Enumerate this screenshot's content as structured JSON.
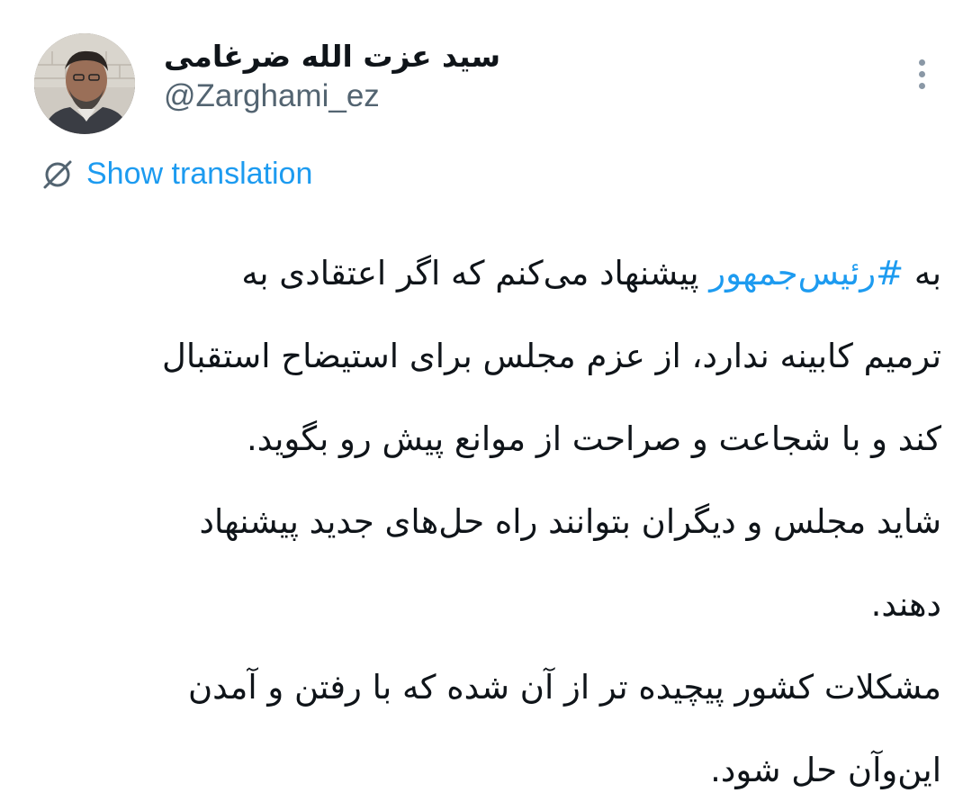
{
  "author": {
    "display_name": "سید عزت الله ضرغامی",
    "handle": "@Zarghami_ez",
    "avatar_icon": "profile-photo"
  },
  "translation": {
    "label": "Show translation",
    "icon": "globe-slash-icon"
  },
  "more_icon": "vertical-ellipsis-icon",
  "tweet": {
    "line1_prefix": "به ",
    "hashtag": "#رئیس‌جمهور",
    "line1_suffix": " پیشنهاد می‌کنم که اگر اعتقادی به",
    "line2": "ترمیم کابینه ندارد، از عزم مجلس برای استیضاح استقبال",
    "line3": "کند و با شجاعت و صراحت از موانع پیش رو بگوید.",
    "line4": "شاید مجلس و دیگران بتوانند راه حل‌های جدید پیشنهاد",
    "line5": "دهند.",
    "line6": "مشکلات کشور پیچیده تر از آن شده که با رفتن و آمدن",
    "line7": "این‌وآن حل شود."
  },
  "colors": {
    "link": "#1d9bf0",
    "text": "#0f1419",
    "secondary": "#536471"
  }
}
